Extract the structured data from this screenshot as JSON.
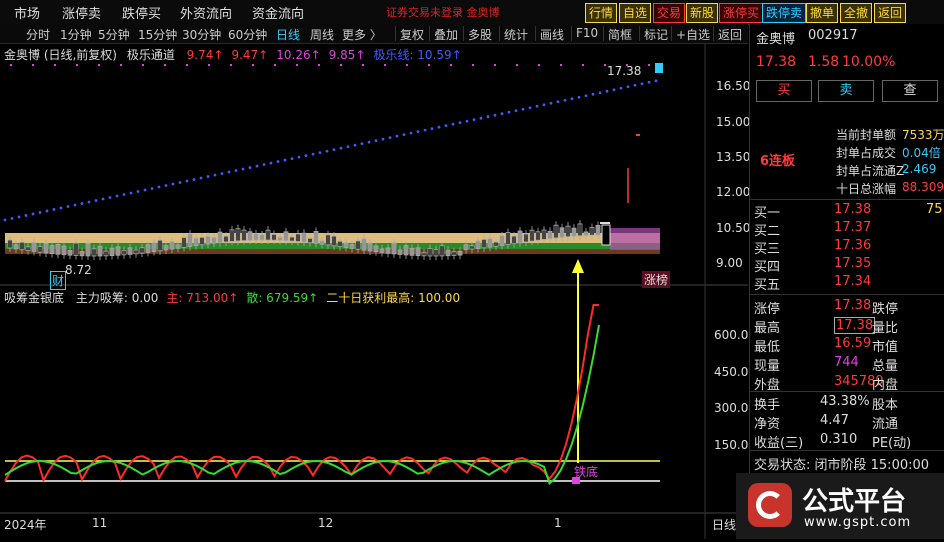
{
  "topbar": {
    "menu": [
      "市场",
      "涨停卖",
      "跌停买",
      "外资流向",
      "资金流向"
    ],
    "notice": "证券交易未登录  金奥博",
    "buttons": [
      {
        "label": "行情",
        "color": "#ffd84a",
        "bg": "#3a3000"
      },
      {
        "label": "自选",
        "color": "#ffd84a",
        "bg": "#3a3000"
      },
      {
        "label": "交易",
        "color": "#ff3b3b",
        "bg": "#3a0000"
      },
      {
        "label": "新股",
        "color": "#ffd84a",
        "bg": "#3a3000"
      },
      {
        "label": "涨停买",
        "color": "#ff3b3b",
        "bg": "#3a0000"
      },
      {
        "label": "跌停卖",
        "color": "#3cf",
        "bg": "#00223a"
      },
      {
        "label": "撤单",
        "color": "#ffd84a",
        "bg": "#3a3000"
      },
      {
        "label": "全撤",
        "color": "#ffd84a",
        "bg": "#3a3000"
      },
      {
        "label": "返回",
        "color": "#ffd84a",
        "bg": "#3a3000"
      }
    ]
  },
  "periodbar": {
    "items": [
      "分时",
      "1分钟",
      "5分钟",
      "15分钟",
      "30分钟",
      "60分钟",
      "日线",
      "周线",
      "更多 〉"
    ],
    "active": "日线",
    "tools": [
      "复权",
      "叠加",
      "多股",
      "统计",
      "画线",
      "F10",
      "简框",
      "标记",
      "+自选",
      "返回"
    ]
  },
  "main_chart": {
    "title": "金奥博 (日线,前复权)",
    "indicator": "极乐通道",
    "values": [
      {
        "text": "9.74↑",
        "color": "#ff3b3b"
      },
      {
        "text": "9.47↑",
        "color": "#ff3b3b"
      },
      {
        "text": "10.26↑",
        "color": "#e040e0"
      },
      {
        "text": "9.85↑",
        "color": "#e040e0"
      },
      {
        "text": "极乐线: 10.59↑",
        "color": "#3c5cff"
      }
    ],
    "price_axis": [
      "16.50",
      "15.00",
      "13.50",
      "12.00",
      "10.50",
      "9.00"
    ],
    "annotations": {
      "high": "17.38",
      "low": "8.72",
      "fin_tag": "财",
      "limit_tag": "涨榜"
    }
  },
  "sub_chart": {
    "title": "吸筹金银底",
    "fields": [
      {
        "text": "主力吸筹: 0.00",
        "color": "#ddd"
      },
      {
        "text": "主: 713.00↑",
        "color": "#ff3b3b"
      },
      {
        "text": "散: 679.59↑",
        "color": "#33dd33"
      },
      {
        "text": "二十日获利最高: 100.00",
        "color": "#ffd84a"
      }
    ],
    "axis": [
      "600.0",
      "450.0",
      "300.0",
      "150.0"
    ],
    "signal_label": "铁底"
  },
  "date_axis": {
    "labels": [
      "2024年",
      "11",
      "12",
      "1"
    ],
    "period": "日线"
  },
  "quote": {
    "name": "金奥博",
    "code": "002917",
    "price": "17.38",
    "change": "1.58",
    "pct": "10.00%",
    "actions": [
      "买",
      "卖",
      "查"
    ],
    "limit_days": "6连板",
    "seal_info": [
      {
        "label": "当前封单额",
        "value": "7533万"
      },
      {
        "label": "封单占成交",
        "value": "0.04倍"
      },
      {
        "label": "封单占流通Z",
        "value": "2.469"
      },
      {
        "label": "十日总涨幅",
        "value": "88.309"
      }
    ],
    "order_book": [
      {
        "label": "买一",
        "price": "17.38",
        "vol": "75"
      },
      {
        "label": "买二",
        "price": "17.37",
        "vol": ""
      },
      {
        "label": "买三",
        "price": "17.36",
        "vol": ""
      },
      {
        "label": "买四",
        "price": "17.35",
        "vol": ""
      },
      {
        "label": "买五",
        "price": "17.34",
        "vol": ""
      }
    ],
    "stats_left": [
      {
        "label": "涨停",
        "value": "17.38",
        "color": "#ff3b3b"
      },
      {
        "label": "最高",
        "value": "17.38",
        "color": "#ff3b3b"
      },
      {
        "label": "最低",
        "value": "16.59",
        "color": "#ff3b3b"
      },
      {
        "label": "现量",
        "value": "744",
        "color": "#e040e0"
      },
      {
        "label": "外盘",
        "value": "345789",
        "color": "#ff3b3b"
      }
    ],
    "stats_right": [
      "跌停",
      "量比",
      "市值",
      "总量",
      "内盘"
    ],
    "turnover": [
      {
        "label": "换手",
        "value": "43.38%",
        "right": "股本"
      },
      {
        "label": "净资",
        "value": "4.47",
        "right": "流通"
      },
      {
        "label": "收益(三)",
        "value": "0.310",
        "right": "PE(动)"
      }
    ],
    "status": "交易状态: 闭市阶段 15:00:00"
  },
  "branding": {
    "name": "公式平台",
    "url": "www.gspt.com"
  }
}
